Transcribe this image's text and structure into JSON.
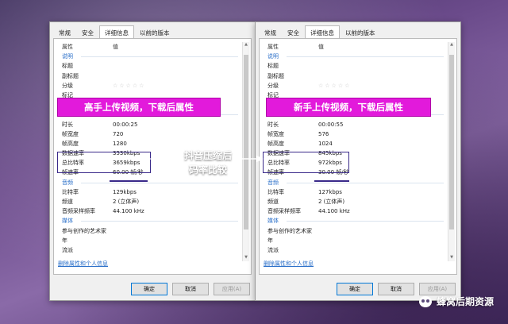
{
  "left": {
    "tabs": [
      "常规",
      "安全",
      "详细信息",
      "以前的版本"
    ],
    "active_tab": 2,
    "rows": [
      {
        "k": "属性",
        "v": "值",
        "t": "header"
      },
      {
        "k": "说明",
        "v": "",
        "t": "section"
      },
      {
        "k": "标题",
        "v": ""
      },
      {
        "k": "副标题",
        "v": ""
      },
      {
        "k": "分级",
        "v": "☆☆☆☆☆",
        "t": "stars"
      },
      {
        "k": "标记",
        "v": ""
      },
      {
        "k": "备注",
        "v": ""
      },
      {
        "k": "视频",
        "v": "",
        "t": "section"
      },
      {
        "k": "时长",
        "v": "00:00:25"
      },
      {
        "k": "帧宽度",
        "v": "720"
      },
      {
        "k": "帧高度",
        "v": "1280"
      },
      {
        "k": "数据速率",
        "v": "3530kbps"
      },
      {
        "k": "总比特率",
        "v": "3659kbps"
      },
      {
        "k": "帧速率",
        "v": "60.00 帧/秒"
      },
      {
        "k": "音频",
        "v": "",
        "t": "section"
      },
      {
        "k": "比特率",
        "v": "129kbps"
      },
      {
        "k": "频道",
        "v": "2 (立体声)"
      },
      {
        "k": "音频采样频率",
        "v": "44.100 kHz"
      },
      {
        "k": "媒体",
        "v": "",
        "t": "section"
      },
      {
        "k": "参与创作的艺术家",
        "v": ""
      },
      {
        "k": "年",
        "v": ""
      },
      {
        "k": "流派",
        "v": ""
      }
    ],
    "remove_link": "删除属性和个人信息",
    "ok": "确定",
    "cancel": "取消",
    "apply": "应用(A)"
  },
  "right": {
    "tabs": [
      "常规",
      "安全",
      "详细信息",
      "以前的版本"
    ],
    "active_tab": 2,
    "rows": [
      {
        "k": "属性",
        "v": "值",
        "t": "header"
      },
      {
        "k": "说明",
        "v": "",
        "t": "section"
      },
      {
        "k": "标题",
        "v": ""
      },
      {
        "k": "副标题",
        "v": ""
      },
      {
        "k": "分级",
        "v": "☆☆☆☆☆",
        "t": "stars"
      },
      {
        "k": "标记",
        "v": ""
      },
      {
        "k": "备注",
        "v": ""
      },
      {
        "k": "视频",
        "v": "",
        "t": "section"
      },
      {
        "k": "时长",
        "v": "00:00:55"
      },
      {
        "k": "帧宽度",
        "v": "576"
      },
      {
        "k": "帧高度",
        "v": "1024"
      },
      {
        "k": "数据速率",
        "v": "845kbps"
      },
      {
        "k": "总比特率",
        "v": "972kbps"
      },
      {
        "k": "帧速率",
        "v": "30.00 帧/秒"
      },
      {
        "k": "音频",
        "v": "",
        "t": "section"
      },
      {
        "k": "比特率",
        "v": "127kbps"
      },
      {
        "k": "频道",
        "v": "2 (立体声)"
      },
      {
        "k": "音频采样频率",
        "v": "44.100 kHz"
      },
      {
        "k": "媒体",
        "v": "",
        "t": "section"
      },
      {
        "k": "参与创作的艺术家",
        "v": ""
      },
      {
        "k": "年",
        "v": ""
      },
      {
        "k": "流派",
        "v": ""
      }
    ],
    "remove_link": "删除属性和个人信息",
    "ok": "确定",
    "cancel": "取消",
    "apply": "应用(A)"
  },
  "banner_left": "高手上传视频，下载后属性",
  "banner_right": "新手上传视频，下载后属性",
  "callout_line1": "抖音压缩后",
  "callout_line2": "码率比较",
  "watermark": "蜂窝后期资源",
  "colors": {
    "banner": "#e21adb",
    "highlight": "#3a2a8a",
    "link": "#2a6fc9"
  }
}
